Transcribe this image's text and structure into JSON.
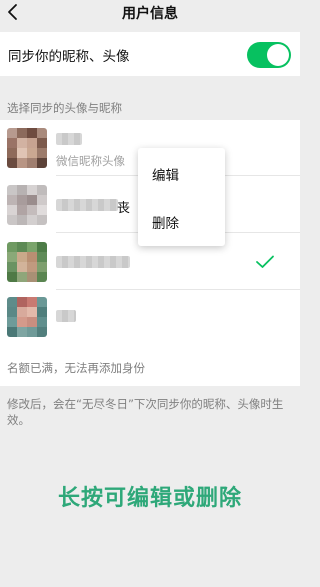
{
  "navbar": {
    "title": "用户信息",
    "back_icon": "back-chevron-icon"
  },
  "sync_setting": {
    "label": "同步你的昵称、头像",
    "enabled": true,
    "toggle_color": "#07c160"
  },
  "section_header": "选择同步的头像与昵称",
  "identities": [
    {
      "name_redacted": true,
      "subtitle": "微信昵称头像",
      "selected": false
    },
    {
      "name_redacted": true,
      "name_visible_suffix": "丧",
      "selected": false
    },
    {
      "name_redacted": true,
      "selected": true
    },
    {
      "name_redacted": true,
      "selected": false
    }
  ],
  "check_icon": "checkmark-icon",
  "accent_color": "#07c160",
  "quota_message": "名额已满，无法再添加身份",
  "notice": "修改后，会在“无尽冬日”下次同步你的昵称、头像时生效。",
  "instruction_overlay": "长按可编辑或删除",
  "context_menu": {
    "edit_label": "编辑",
    "delete_label": "删除"
  }
}
